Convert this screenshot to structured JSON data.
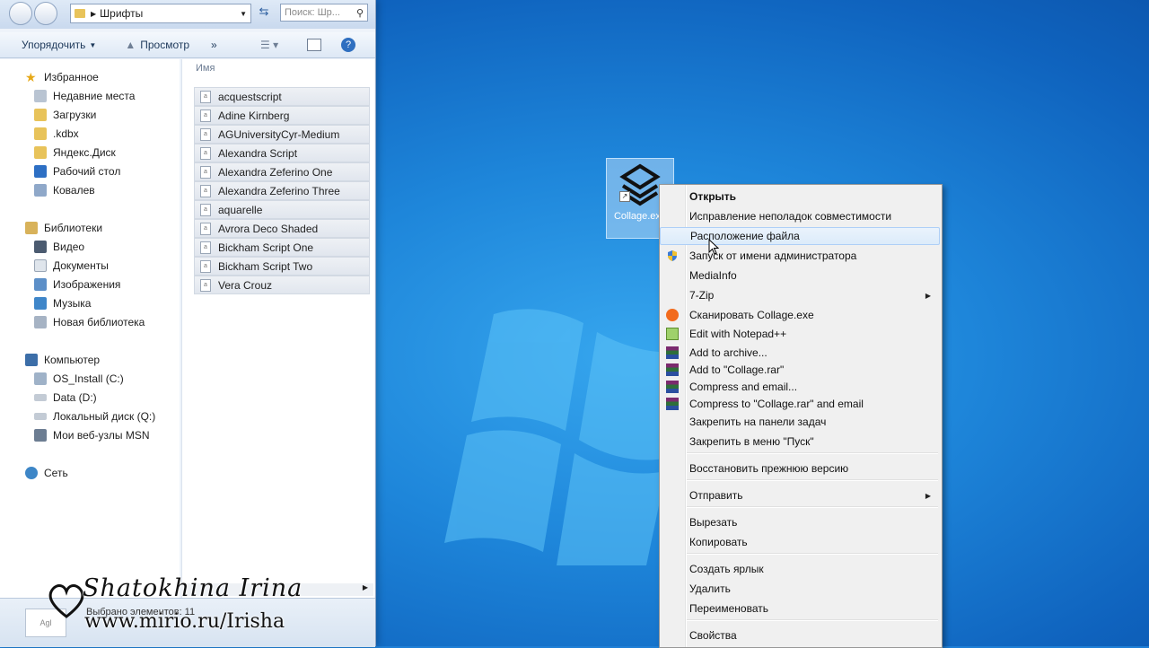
{
  "explorer": {
    "address": "Шрифты",
    "search_placeholder": "Поиск: Шр...",
    "toolbar": {
      "organize": "Упорядочить",
      "view": "Просмотр",
      "more": "»"
    },
    "column_header": "Имя",
    "nav": {
      "favorites_header": "Избранное",
      "favorites": [
        "Недавние места",
        "Загрузки",
        ".kdbx",
        "Яндекс.Диск",
        "Рабочий стол",
        "Ковалев"
      ],
      "libraries_header": "Библиотеки",
      "libraries": [
        "Видео",
        "Документы",
        "Изображения",
        "Музыка",
        "Новая библиотека"
      ],
      "computer_header": "Компьютер",
      "computer": [
        "OS_Install (C:)",
        "Data (D:)",
        "Локальный диск (Q:)",
        "Мои веб-узлы MSN"
      ],
      "network_header": "Сеть"
    },
    "files": [
      "acquestscript",
      "Adine Kirnberg",
      "AGUniversityCyr-Medium",
      "Alexandra Script",
      "Alexandra Zeferino One",
      "Alexandra Zeferino Three",
      "aquarelle",
      "Avrora Deco Shaded",
      "Bickham Script One",
      "Bickham Script Two",
      "Vera Crouz"
    ],
    "status": "Выбрано элементов: 11"
  },
  "watermark": {
    "signature": "Shatokhina Irina",
    "url": "www.mirio.ru/Irisha"
  },
  "desktop_icon": {
    "label": "Collage.exe"
  },
  "context_menu": {
    "items": [
      {
        "label": "Открыть",
        "bold": true
      },
      {
        "label": "Исправление неполадок совместимости"
      },
      {
        "label": "Расположение файла",
        "highlighted": true
      },
      {
        "label": "Запуск от имени администратора",
        "icon": "shield-icon"
      },
      {
        "label": "MediaInfo"
      },
      {
        "label": "7-Zip",
        "submenu": true
      },
      {
        "label": "Сканировать Collage.exe",
        "icon": "avast-icon"
      },
      {
        "label": "Edit with Notepad++",
        "icon": "notepad-icon"
      },
      {
        "label": "Add to archive...",
        "icon": "winrar-icon"
      },
      {
        "label": "Add to \"Collage.rar\"",
        "icon": "winrar-icon"
      },
      {
        "label": "Compress and email...",
        "icon": "winrar-icon"
      },
      {
        "label": "Compress to \"Collage.rar\" and email",
        "icon": "winrar-icon"
      },
      {
        "label": "Закрепить на панели задач"
      },
      {
        "label": "Закрепить в меню \"Пуск\""
      },
      {
        "label": "Восстановить прежнюю версию"
      },
      {
        "label": "Отправить",
        "submenu": true
      },
      {
        "label": "Вырезать"
      },
      {
        "label": "Копировать"
      },
      {
        "label": "Создать ярлык"
      },
      {
        "label": "Удалить"
      },
      {
        "label": "Переименовать"
      },
      {
        "label": "Свойства"
      }
    ]
  }
}
